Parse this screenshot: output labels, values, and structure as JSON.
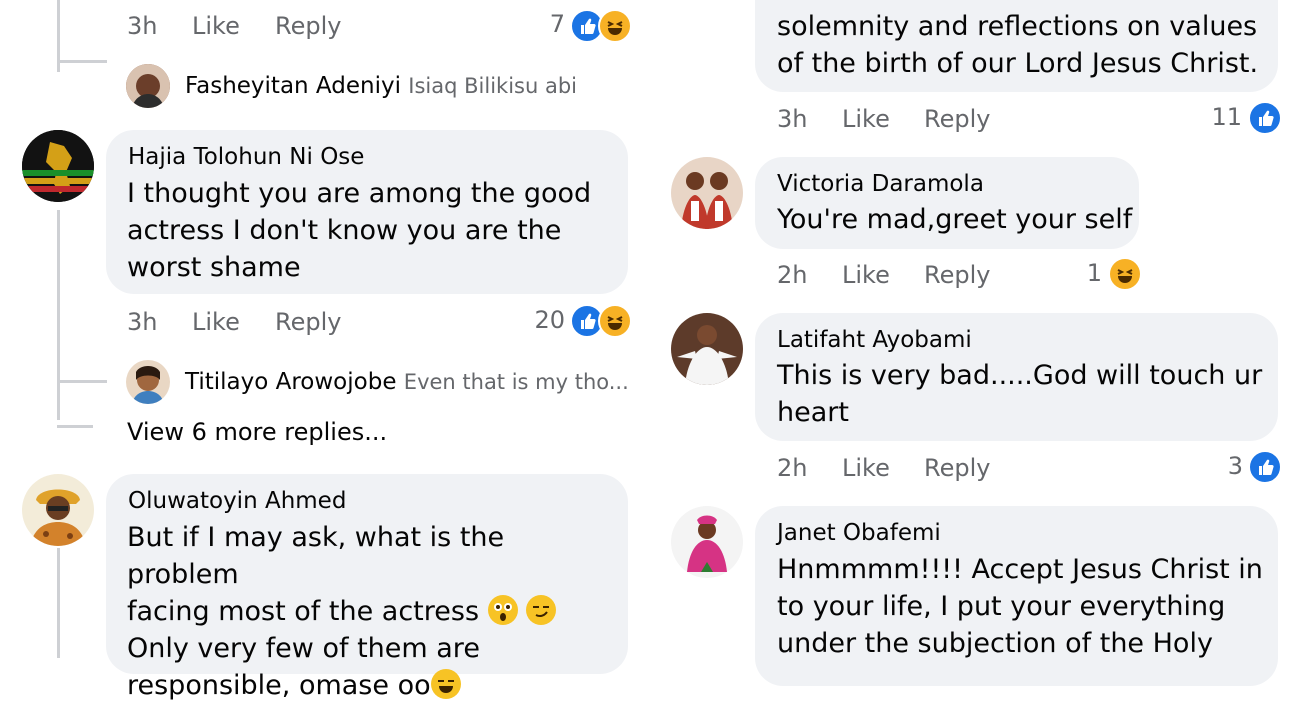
{
  "left": {
    "top_comment_meta": {
      "time": "3h",
      "like": "Like",
      "reply": "Reply",
      "count": "7"
    },
    "reply1": {
      "name": "Fasheyitan Adeniyi",
      "text": "Isiaq Bilikisu abi"
    },
    "c1": {
      "name": "Hajia Tolohun Ni Ose",
      "text": "I thought you are among the good\nactress I don't know you are the\nworst shame",
      "time": "3h",
      "like": "Like",
      "reply": "Reply",
      "count": "20"
    },
    "reply2": {
      "name": "Titilayo Arowojobe",
      "text": "Even that is my tho..."
    },
    "view_more": "View 6 more replies...",
    "c2": {
      "name": "Oluwatoyin Ahmed",
      "line1": "But if I may ask, what is the problem",
      "line2": "facing most of the actress",
      "line3": "Only very few of them are",
      "line4": "responsible, omase oo"
    }
  },
  "right": {
    "c0": {
      "text": "solemnity and reflections on values\nof the birth of our Lord Jesus Christ.",
      "time": "3h",
      "like": "Like",
      "reply": "Reply",
      "count": "11"
    },
    "c1": {
      "name": "Victoria Daramola",
      "text": "You're mad,greet your self",
      "time": "2h",
      "like": "Like",
      "reply": "Reply",
      "count": "1"
    },
    "c2": {
      "name": "Latifaht Ayobami",
      "text": "This is very bad.....God will touch ur\nheart",
      "time": "2h",
      "like": "Like",
      "reply": "Reply",
      "count": "3"
    },
    "c3": {
      "name": "Janet Obafemi",
      "text": "Hnmmmm!!!! Accept Jesus Christ in\nto your life, I put your everything\nunder the subjection of the Holy"
    }
  },
  "colors": {
    "bubble": "#f0f2f5",
    "meta": "#65676b",
    "like": "#1b74e4",
    "haha": "#f7b125"
  }
}
